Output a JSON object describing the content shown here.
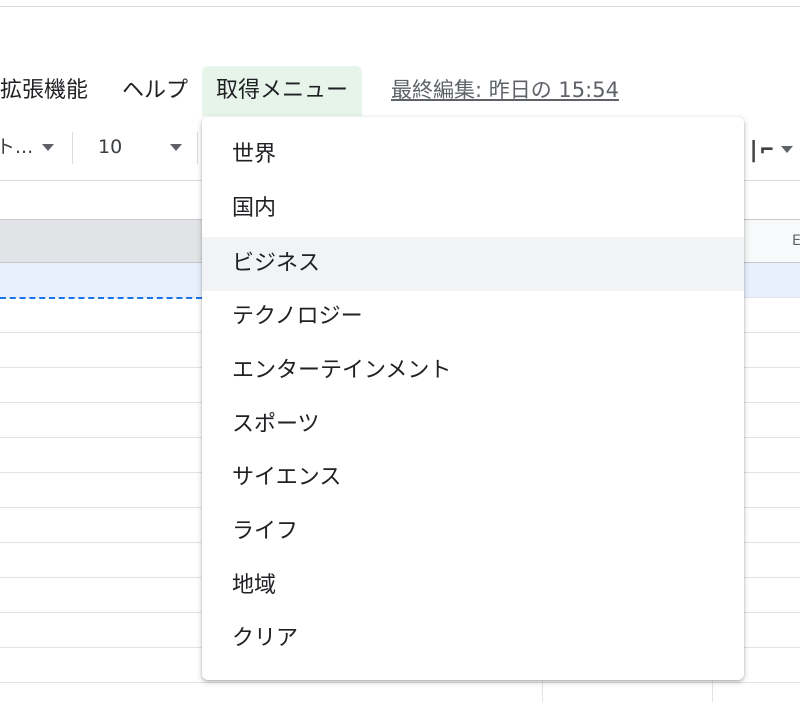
{
  "menubar": {
    "items": [
      {
        "label": "拡張機能"
      },
      {
        "label": "ヘルプ"
      },
      {
        "label": "取得メニュー"
      }
    ],
    "last_edit": "最終編集: 昨日の 15:54"
  },
  "toolbar": {
    "font_name": "ト...",
    "font_size": "10",
    "right_icon": "text-wrap-icon"
  },
  "columns": {
    "visible_label": "E"
  },
  "dropdown": {
    "items": [
      {
        "label": "世界"
      },
      {
        "label": "国内"
      },
      {
        "label": "ビジネス"
      },
      {
        "label": "テクノロジー"
      },
      {
        "label": "エンターテインメント"
      },
      {
        "label": "スポーツ"
      },
      {
        "label": "サイエンス"
      },
      {
        "label": "ライフ"
      },
      {
        "label": "地域"
      },
      {
        "label": "クリア"
      }
    ],
    "hovered_index": 2
  },
  "colors": {
    "active_menu_bg": "#e6f4ea",
    "hover_bg": "#f1f3f4",
    "selection_blue": "#1a73e8"
  }
}
